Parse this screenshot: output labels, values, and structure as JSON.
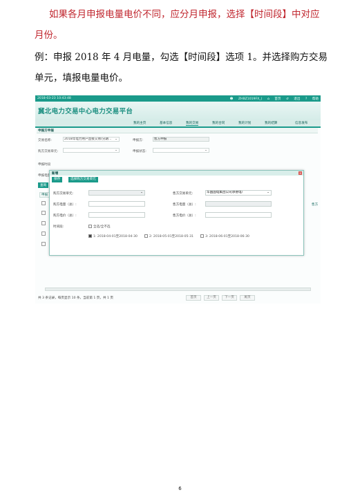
{
  "doc": {
    "para1_red": "如果各月申报电量电价不同，应分月申报，选择【时间段】中对应月份。",
    "para2": "例：申报 2018 年 4 月电量，勾选【时间段】选项 1。并选择购方交易单元，填报电量电价。",
    "page_number": "6"
  },
  "screenshot": {
    "topbar": {
      "datetime": "2018-03-23 10:43:48",
      "user": "ZHBZ1019FX_)",
      "home": "首页",
      "logout": "退出",
      "help": "帮助"
    },
    "platform_title": "冀北电力交易中心电力交易平台",
    "nav": [
      "我的主页",
      "基本信息",
      "我的交易",
      "我的合同",
      "我的计划",
      "我的结算",
      "信息发布"
    ],
    "panel_title": "申报方申报",
    "form": {
      "trade_name_label": "交易名称:",
      "trade_name_value": "2018年电力用户直接交易(分期...",
      "role_label": "申报方:",
      "role_value": "售方申报",
      "buyer_unit_label": "购方交易单元:",
      "declare_status_label": "申报状态:",
      "row3_label": "申报时段",
      "row4_label": "申报电量",
      "query_button": "查询"
    },
    "tab_stub": "申报",
    "right_stub": "售方",
    "pager": "共 3 条记录，每页显示 10 条，当前第 1 页，共 1 页",
    "pager_buttons": [
      "首页",
      "上一页",
      "下一页",
      "尾页"
    ],
    "modal": {
      "title": "新增",
      "save_button": "保存",
      "select_button": "选择购方交易单元",
      "buyer_unit_label": "购方交易单元:",
      "seller_unit_label": "售方交易单元:",
      "seller_unit_value": "华国国电集团公司承德电厂",
      "buyer_energy_label": "购方电量（总）:",
      "seller_energy_label": "售方电量（总）:",
      "buyer_price_label": "购方电价（总）:",
      "seller_price_label": "售方电价（总）:",
      "period_label": "时间段:",
      "select_all": "全选/全不选",
      "periods": [
        "1: 2018-04-01至2018-04-30",
        "2: 2018-05-01至2018-05-31",
        "3: 2018-06-01至2018-06-30"
      ]
    }
  }
}
